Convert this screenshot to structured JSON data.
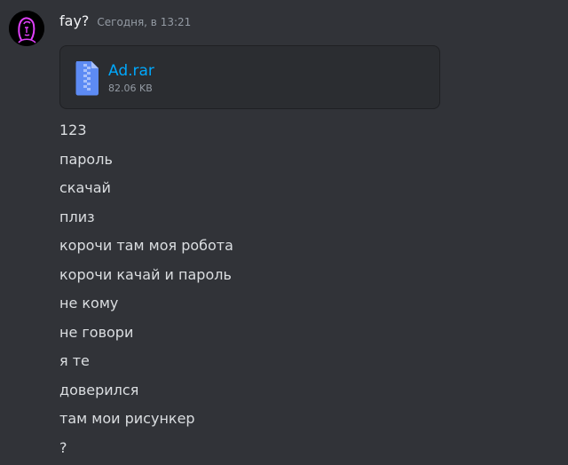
{
  "message": {
    "username": "fay?",
    "timestamp": "Сегодня, в 13:21",
    "avatar_icon": "hooded-figure-avatar",
    "attachment": {
      "file_name": "Ad.rar",
      "file_size": "82.06 KB",
      "icon": "zip-archive-icon"
    },
    "lines": [
      "123",
      "пароль",
      "скачай",
      "плиз",
      "корочи там моя робота",
      "корочи качай и пароль",
      "не кому",
      "не говори",
      "я те",
      "доверился",
      "там мои рисункер",
      "?"
    ]
  },
  "colors": {
    "background": "#313338",
    "attachment_bg": "#2b2d31",
    "link": "#00a8fc",
    "avatar_accent": "#e040fb"
  }
}
